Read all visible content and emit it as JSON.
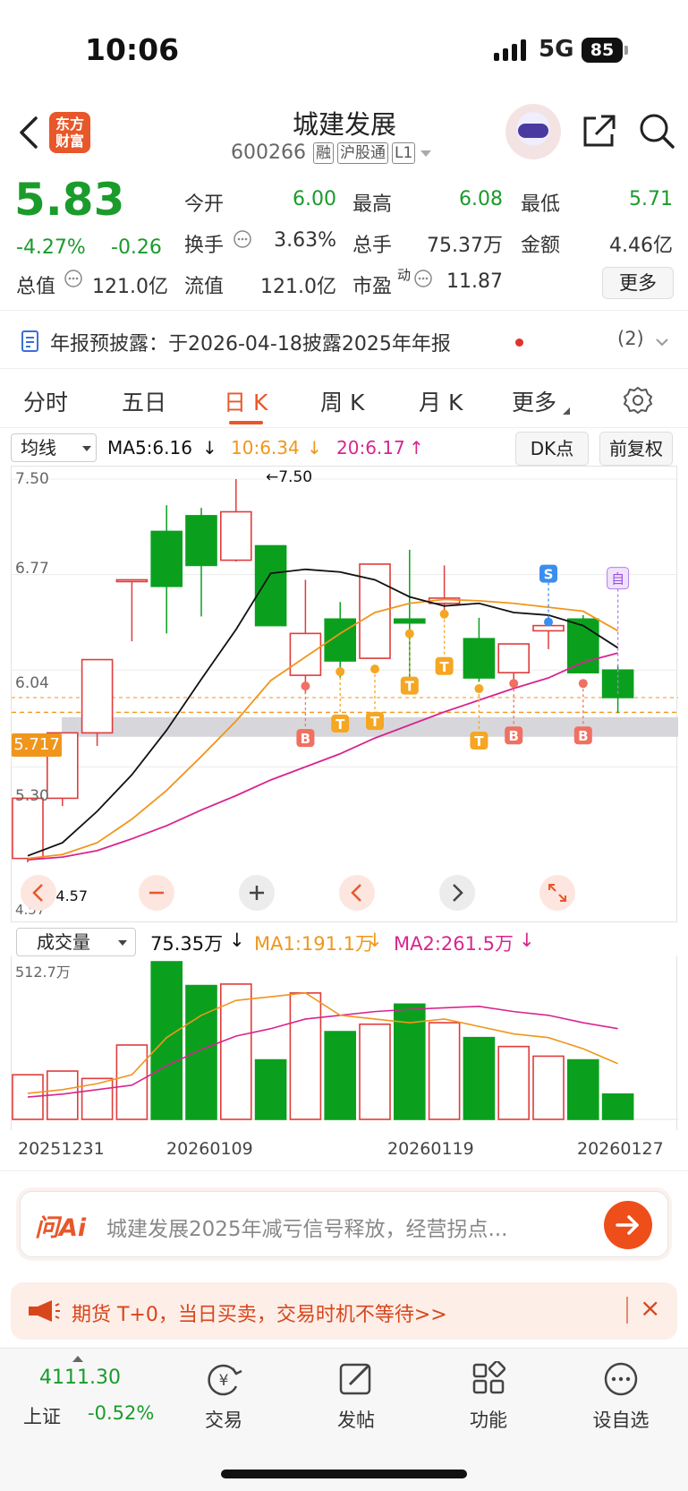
{
  "status": {
    "time": "10:06",
    "network": "5G",
    "battery": "85"
  },
  "header": {
    "logo": "东方\n财富",
    "logo_line1": "东方",
    "logo_line2": "财富",
    "title": "城建发展",
    "code": "600266",
    "tags": [
      "融",
      "沪股通",
      "L1"
    ]
  },
  "quote": {
    "price": "5.83",
    "change_pct": "-4.27%",
    "change": "-0.26",
    "open_label": "今开",
    "open": "6.00",
    "high_label": "最高",
    "high": "6.08",
    "low_label": "最低",
    "low": "5.71",
    "turnover_label": "换手",
    "turnover": "3.63%",
    "volume_label": "总手",
    "volume": "75.37万",
    "amount_label": "金额",
    "amount": "4.46亿",
    "mktcap_label": "总值",
    "mktcap": "121.0亿",
    "float_label": "流值",
    "float": "121.0亿",
    "pe_label": "市盈",
    "pe_sup": "动",
    "pe": "11.87",
    "more_label": "更多"
  },
  "notice": {
    "text": "年报预披露：于2026-04-18披露2025年年报",
    "count": "(2)"
  },
  "tabs": [
    "分时",
    "五日",
    "日 K",
    "周 K",
    "月 K",
    "更多"
  ],
  "ma_row": {
    "selector": "均线",
    "ma5": "MA5:6.16",
    "ma10": "10:6.34",
    "ma20": "20:6.17",
    "dk_label": "DK点",
    "adjust_label": "前复权"
  },
  "price_axis": {
    "top": "7.50",
    "l2": "6.77",
    "l3": "6.04",
    "l4": "5.30",
    "bottom": "4.57",
    "current": "5.717",
    "max_mark": "←7.50",
    "min_mark": "←4.57"
  },
  "volume_row": {
    "selector": "成交量",
    "vol": "75.35万",
    "ma1": "MA1:191.1万",
    "ma2": "MA2:261.5万",
    "axis_top": "512.7万"
  },
  "x_dates": [
    "20251231",
    "20260109",
    "20260119",
    "20260127"
  ],
  "signal_labels": {
    "buy": "B",
    "sell": "S",
    "t": "T",
    "self": "自"
  },
  "colors": {
    "up": "#e03c3c",
    "down": "#0aa01e",
    "ma5": "#111111",
    "ma10": "#f0961c",
    "ma20": "#d8258f",
    "accent": "#e8572a"
  },
  "chart_data": {
    "type": "candlestick",
    "ylim": [
      4.57,
      7.5
    ],
    "candles": [
      {
        "o": 4.6,
        "c": 5.06,
        "h": 5.06,
        "l": 4.57,
        "up": true
      },
      {
        "o": 5.06,
        "c": 5.56,
        "h": 5.56,
        "l": 5.0,
        "up": true
      },
      {
        "o": 5.56,
        "c": 6.12,
        "h": 6.12,
        "l": 5.46,
        "up": true
      },
      {
        "o": 6.73,
        "c": 6.73,
        "h": 6.73,
        "l": 6.26,
        "up": true
      },
      {
        "o": 7.1,
        "c": 6.68,
        "h": 7.3,
        "l": 6.32,
        "up": false
      },
      {
        "o": 7.22,
        "c": 6.84,
        "h": 7.28,
        "l": 6.45,
        "up": false
      },
      {
        "o": 6.88,
        "c": 7.25,
        "h": 7.5,
        "l": 6.87,
        "up": true
      },
      {
        "o": 6.99,
        "c": 6.38,
        "h": 6.99,
        "l": 6.38,
        "up": false
      },
      {
        "o": 6.0,
        "c": 6.32,
        "h": 6.73,
        "l": 5.86,
        "up": true
      },
      {
        "o": 6.43,
        "c": 6.11,
        "h": 6.56,
        "l": 5.98,
        "up": false
      },
      {
        "o": 6.13,
        "c": 6.85,
        "h": 6.85,
        "l": 6.13,
        "up": true
      },
      {
        "o": 6.43,
        "c": 6.4,
        "h": 6.96,
        "l": 5.86,
        "up": false
      },
      {
        "o": 6.55,
        "c": 6.59,
        "h": 6.84,
        "l": 6.49,
        "up": true
      },
      {
        "o": 6.28,
        "c": 5.98,
        "h": 6.44,
        "l": 5.95,
        "up": false
      },
      {
        "o": 6.02,
        "c": 6.24,
        "h": 6.24,
        "l": 5.97,
        "up": true
      },
      {
        "o": 6.38,
        "c": 6.34,
        "h": 6.46,
        "l": 6.2,
        "up": true
      },
      {
        "o": 6.43,
        "c": 6.02,
        "h": 6.46,
        "l": 6.02,
        "up": false
      },
      {
        "o": 6.04,
        "c": 5.83,
        "h": 6.08,
        "l": 5.71,
        "up": false
      }
    ],
    "ma5": [
      4.62,
      4.72,
      4.96,
      5.24,
      5.58,
      5.97,
      6.35,
      6.78,
      6.81,
      6.79,
      6.73,
      6.6,
      6.53,
      6.55,
      6.48,
      6.46,
      6.38,
      6.21
    ],
    "ma10": [
      4.6,
      4.63,
      4.72,
      4.9,
      5.12,
      5.38,
      5.65,
      5.96,
      6.14,
      6.32,
      6.48,
      6.55,
      6.58,
      6.57,
      6.55,
      6.52,
      6.49,
      6.34
    ],
    "ma20": [
      4.59,
      4.61,
      4.66,
      4.75,
      4.85,
      4.97,
      5.08,
      5.2,
      5.3,
      5.4,
      5.52,
      5.62,
      5.72,
      5.81,
      5.9,
      5.98,
      6.1,
      6.17
    ],
    "volume": [
      60,
      65,
      55,
      100,
      212,
      180,
      182,
      80,
      170,
      118,
      128,
      155,
      130,
      110,
      98,
      85,
      80,
      34
    ],
    "vol_ma1": [
      35,
      40,
      48,
      60,
      110,
      140,
      160,
      165,
      170,
      140,
      135,
      130,
      135,
      125,
      115,
      110,
      95,
      75
    ],
    "vol_ma2": [
      30,
      34,
      40,
      46,
      72,
      94,
      112,
      122,
      135,
      140,
      145,
      148,
      150,
      152,
      145,
      140,
      130,
      122
    ],
    "vol_ylim": [
      0,
      212
    ],
    "signals": [
      {
        "i": 8,
        "type": "B",
        "side": "below"
      },
      {
        "i": 9,
        "type": "T",
        "side": "below"
      },
      {
        "i": 10,
        "type": "T",
        "side": "below"
      },
      {
        "i": 11,
        "type": "T",
        "side": "below"
      },
      {
        "i": 12,
        "type": "T",
        "side": "below"
      },
      {
        "i": 13,
        "type": "T",
        "side": "below"
      },
      {
        "i": 14,
        "type": "B",
        "side": "below"
      },
      {
        "i": 15,
        "type": "S",
        "side": "above"
      },
      {
        "i": 16,
        "type": "B",
        "side": "below"
      }
    ]
  },
  "ai": {
    "logo": "问Ai",
    "text": "城建发展2025年减亏信号释放，经营拐点..."
  },
  "promo": {
    "text": "期货 T+0，当日买卖，交易时机不等待>>",
    "close": "×"
  },
  "bottom_nav": {
    "index_value": "4111.30",
    "index_name": "上证",
    "index_change": "-0.52%",
    "items": [
      "交易",
      "发帖",
      "功能",
      "设自选"
    ]
  }
}
